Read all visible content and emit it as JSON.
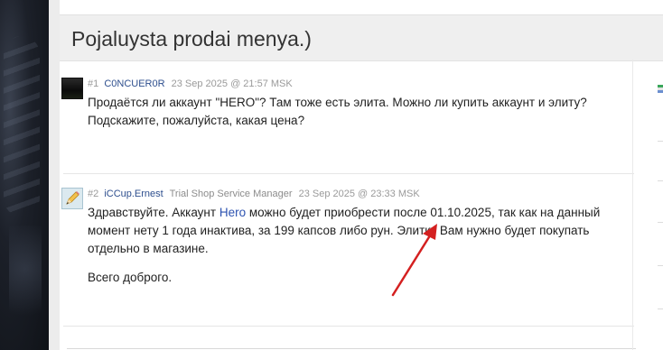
{
  "topic": {
    "title": "Pojaluysta prodai menya.)"
  },
  "posts": [
    {
      "number": "#1",
      "author": "C0NCUER0R",
      "role": "",
      "date": "23 Sep 2025 @ 21:57 MSK",
      "lines": [
        "Продаётся ли аккаунт \"HERO\"? Там тоже есть элита. Можно ли купить аккаунт и элиту?",
        "Подскажите, пожалуйста, какая цена?"
      ]
    },
    {
      "number": "#2",
      "author": "iCCup.Ernest",
      "role": "Trial Shop Service Manager",
      "date": "23 Sep 2025 @ 23:33 MSK",
      "body_pre_link": "Здравствуйте. Аккаунт ",
      "link_text": "Hero",
      "body_post_link": " можно будет приобрести после 01.10.2025, так как на данный момент нету 1 года инактива, за 199 капсов либо рун. Элитку Вам нужно будет покупать отдельно в магазине.",
      "closing": "Всего доброго."
    }
  ],
  "colors": {
    "author_link": "#2e4f8e",
    "hero_link": "#2c52b0",
    "arrow": "#d42020"
  },
  "icons": {
    "avatar_2": "pencil-icon",
    "side_icon": "flag-icon"
  }
}
